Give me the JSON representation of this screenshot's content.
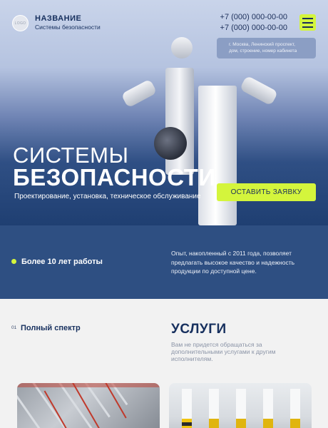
{
  "header": {
    "logo_text": "LOGO",
    "brand_name": "НАЗВАНИЕ",
    "brand_subtitle": "Системы безопасности",
    "phones": [
      "+7 (000) 000-00-00",
      "+7 (000) 000-00-00"
    ],
    "address_line1": "г. Москва, Ленинский проспект,",
    "address_line2": "дом, строение, номер кабинета"
  },
  "hero": {
    "title_line1": "СИСТЕМЫ",
    "title_line2": "БЕЗОПАСНОСТИ",
    "subtitle": "Проектирование, установка, техническое обслуживание",
    "cta_label": "ОСТАВИТЬ ЗАЯВКУ"
  },
  "experience": {
    "years_label": "Более 10 лет работы",
    "description": "Опыт, накопленный с 2011 года, позволяет предлагать высокое качество и надежность продукции по доступной цене."
  },
  "services": {
    "number": "01",
    "item_title": "Полный спектр",
    "section_title": "УСЛУГИ",
    "section_text": "Вам не придется обращаться за дополнительными услугами к другим исполнителям."
  },
  "colors": {
    "accent": "#d4f53c",
    "navy": "#17305e",
    "band": "#2e4f82"
  }
}
